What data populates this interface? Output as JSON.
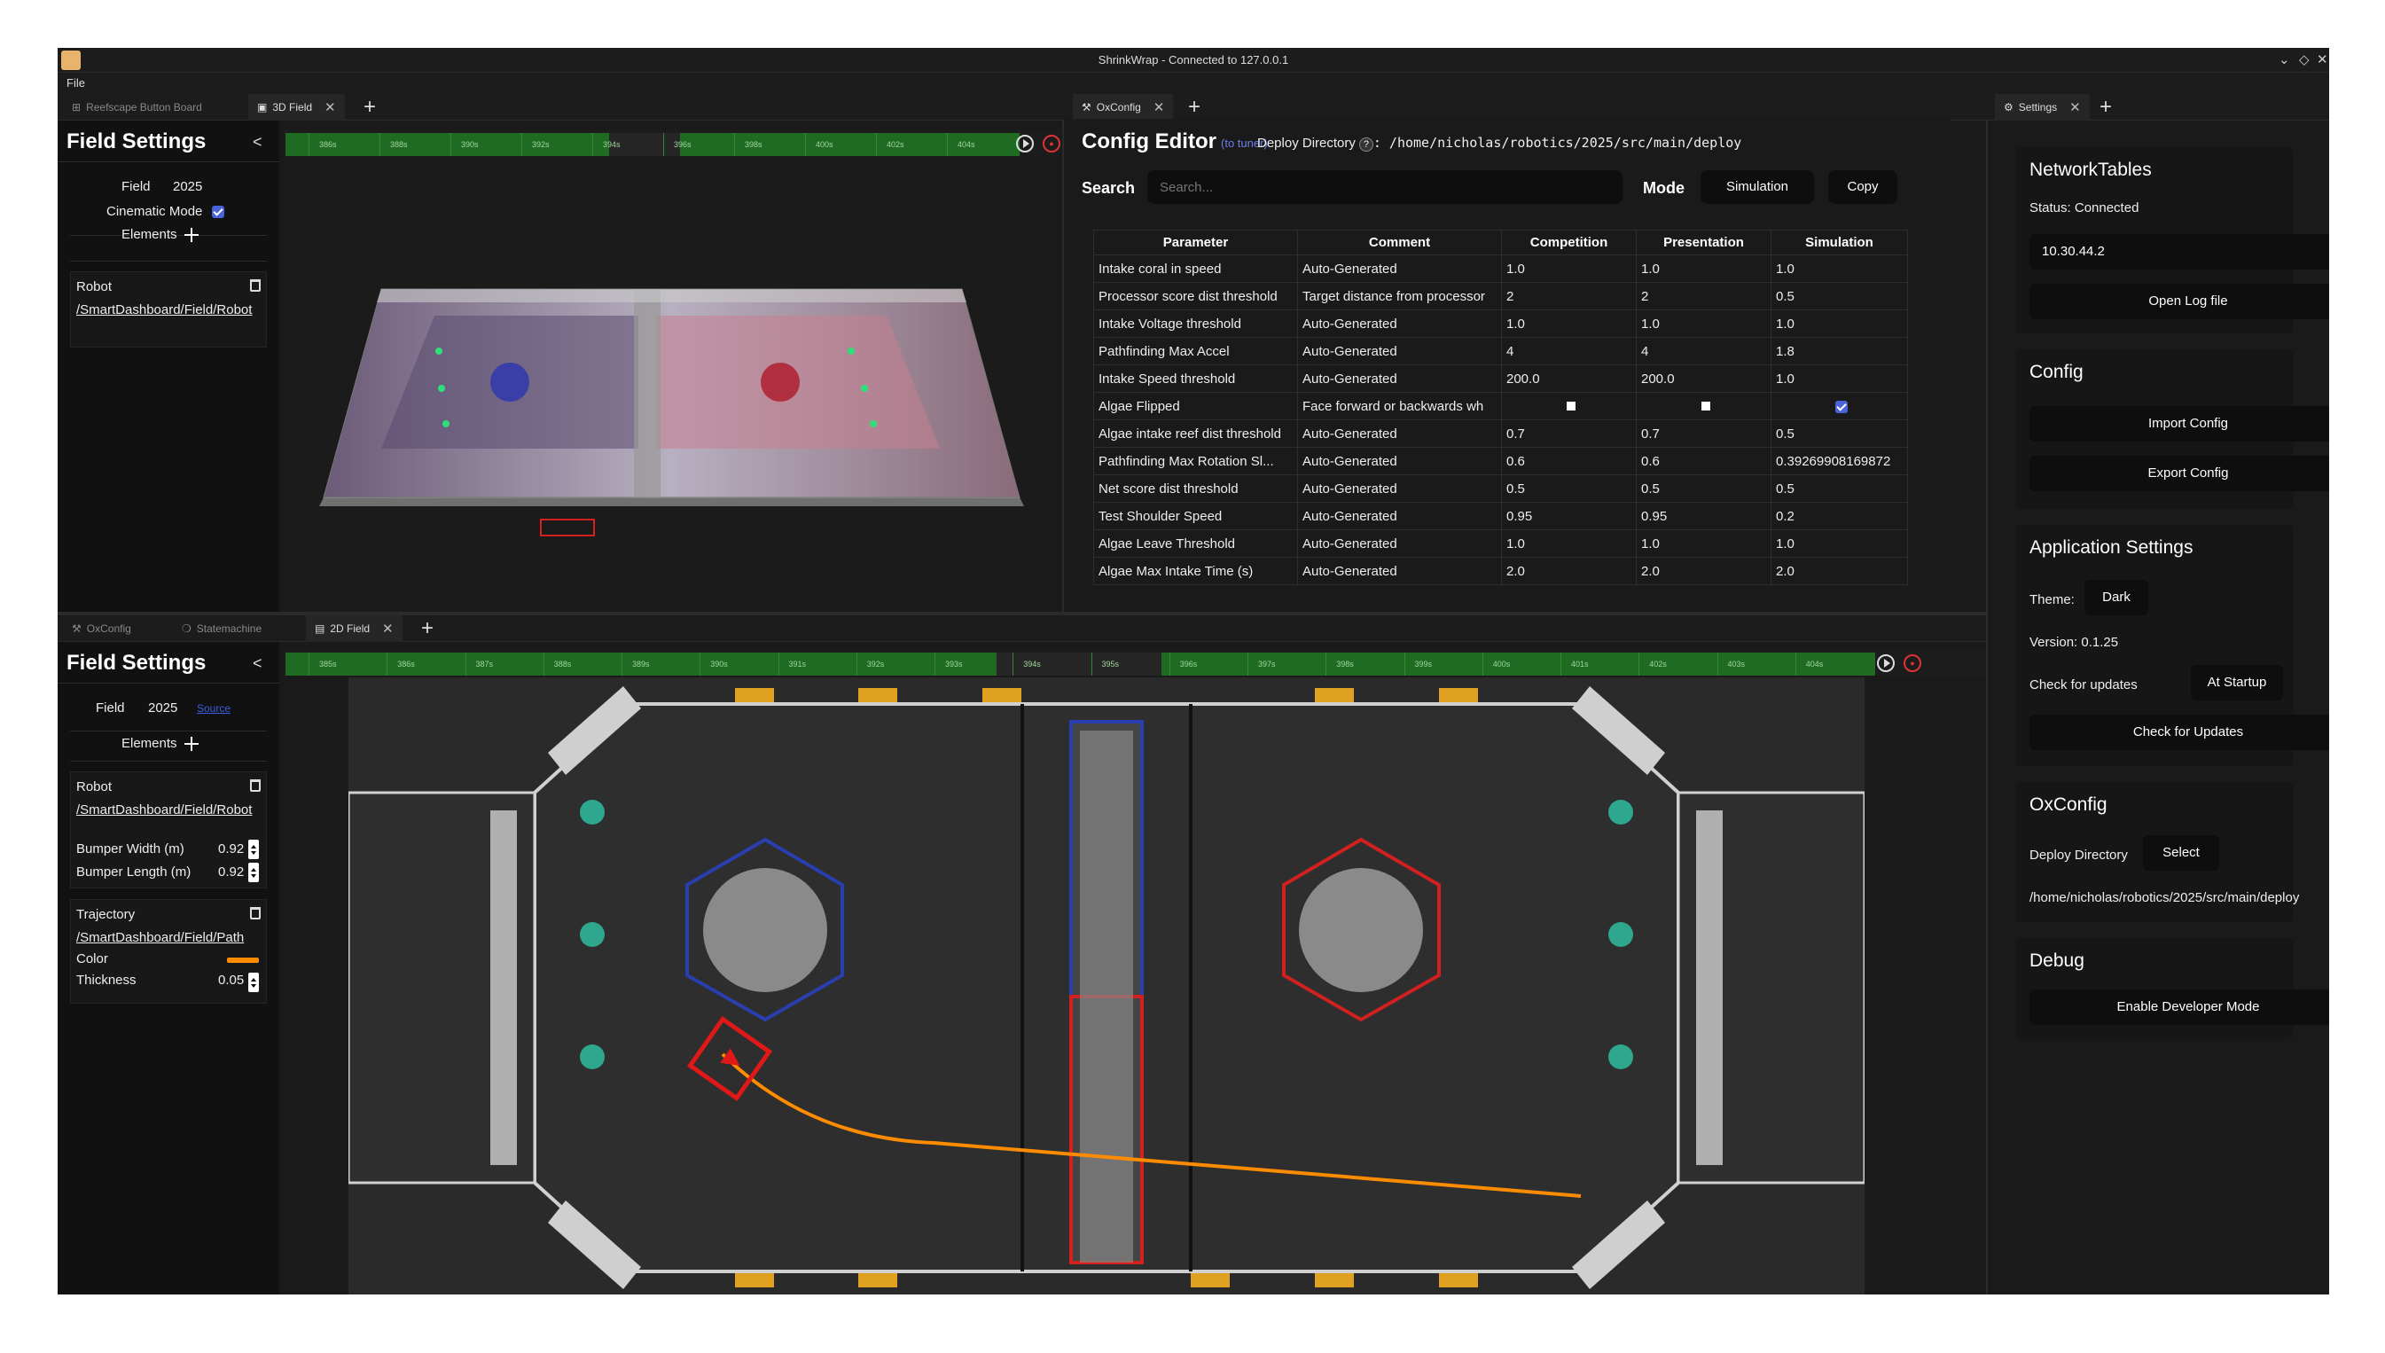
{
  "window": {
    "title": "ShrinkWrap - Connected to 127.0.0.1",
    "controls": [
      "⌄",
      "◇",
      "✕"
    ]
  },
  "menu": {
    "file": "File"
  },
  "tabs_top_left": [
    {
      "label": "Reefscape Button Board"
    },
    {
      "label": "3D Field"
    }
  ],
  "tabs_top_middle": [
    {
      "label": "OxConfig"
    }
  ],
  "tabs_right": [
    {
      "label": "Settings"
    }
  ],
  "tabs_bottom_left": [
    {
      "label": "OxConfig"
    },
    {
      "label": "Statemachine"
    },
    {
      "label": "2D Field"
    }
  ],
  "timeline_labels_top": [
    "386s",
    "388s",
    "390s",
    "392s",
    "394s",
    "396s",
    "398s",
    "400s",
    "402s",
    "404s"
  ],
  "timeline_labels_bottom": [
    "385s",
    "386s",
    "387s",
    "388s",
    "389s",
    "390s",
    "391s",
    "392s",
    "393s",
    "394s",
    "395s",
    "396s",
    "397s",
    "398s",
    "399s",
    "400s",
    "401s",
    "402s",
    "403s",
    "404s"
  ],
  "field3d_settings": {
    "title": "Field Settings",
    "collapse": "<",
    "field_label": "Field",
    "field_value": "2025",
    "cinematic_label": "Cinematic Mode",
    "elements_label": "Elements",
    "robot_card": {
      "title": "Robot",
      "topic": "/SmartDashboard/Field/Robot"
    }
  },
  "field2d_settings": {
    "title": "Field Settings",
    "collapse": "<",
    "field_label": "Field",
    "field_value": "2025",
    "field_link": "Source",
    "elements_label": "Elements",
    "robot_card": {
      "title": "Robot",
      "topic": "/SmartDashboard/Field/Robot",
      "bw_label": "Bumper Width (m)",
      "bw_value": "0.92",
      "bl_label": "Bumper Length (m)",
      "bl_value": "0.92"
    },
    "traj_card": {
      "title": "Trajectory",
      "topic": "/SmartDashboard/Field/Path",
      "color_label": "Color",
      "color": "#ff8c00",
      "thick_label": "Thickness",
      "thick_value": "0.05"
    }
  },
  "config_editor": {
    "title": "Config Editor",
    "tuner": "(to tuner)",
    "deploy_label": "Deploy Directory",
    "deploy_q": "?",
    "deploy_path": ": /home/nicholas/robotics/2025/src/main/deploy",
    "search_label": "Search",
    "search_placeholder": "Search...",
    "mode_label": "Mode",
    "mode_value": "Simulation",
    "copy_label": "Copy",
    "columns": [
      "Parameter",
      "Comment",
      "Competition",
      "Presentation",
      "Simulation"
    ],
    "rows": [
      [
        "Intake coral in speed",
        "Auto-Generated",
        "1.0",
        "1.0",
        "1.0"
      ],
      [
        "Processor score dist threshold",
        "Target distance from processor",
        "2",
        "2",
        "0.5"
      ],
      [
        "Intake Voltage threshold",
        "Auto-Generated",
        "1.0",
        "1.0",
        "1.0"
      ],
      [
        "Pathfinding Max Accel",
        "Auto-Generated",
        "4",
        "4",
        "1.8"
      ],
      [
        "Intake Speed threshold",
        "Auto-Generated",
        "200.0",
        "200.0",
        "1.0"
      ],
      [
        "Algae Flipped",
        "Face forward or backwards wh",
        "□",
        "□",
        "☑"
      ],
      [
        "Algae intake reef dist threshold",
        "Auto-Generated",
        "0.7",
        "0.7",
        "0.5"
      ],
      [
        "Pathfinding Max Rotation Sl...",
        "Auto-Generated",
        "0.6",
        "0.6",
        "0.39269908169872"
      ],
      [
        "Net score dist threshold",
        "Auto-Generated",
        "0.5",
        "0.5",
        "0.5"
      ],
      [
        "Test Shoulder Speed",
        "Auto-Generated",
        "0.95",
        "0.95",
        "0.2"
      ],
      [
        "Algae Leave Threshold",
        "Auto-Generated",
        "1.0",
        "1.0",
        "1.0"
      ],
      [
        "Algae Max Intake Time (s)",
        "Auto-Generated",
        "2.0",
        "2.0",
        "2.0"
      ]
    ]
  },
  "settings": {
    "networktables": {
      "title": "NetworkTables",
      "status": "Status: Connected",
      "address": "10.30.44.2",
      "open_log": "Open Log file"
    },
    "config": {
      "title": "Config",
      "import": "Import Config",
      "export": "Export Config"
    },
    "app": {
      "title": "Application Settings",
      "theme_label": "Theme:",
      "theme_value": "Dark",
      "version": "Version: 0.1.25",
      "updates_label": "Check for updates",
      "updates_value": "At Startup",
      "check_btn": "Check for Updates"
    },
    "oxconfig": {
      "title": "OxConfig",
      "deploy_label": "Deploy Directory",
      "select_btn": "Select",
      "path": "/home/nicholas/robotics/2025/src/main/deploy"
    },
    "debug": {
      "title": "Debug",
      "dev_btn": "Enable Developer Mode"
    }
  },
  "field2d": {
    "path_color": "#ff8c00",
    "blue_color": "#2a3faf",
    "red_color": "#d02020",
    "algae_color": "#2fa68e",
    "robot_pose": {
      "x": 1.4,
      "y": 2.8,
      "heading_deg": 35
    }
  }
}
